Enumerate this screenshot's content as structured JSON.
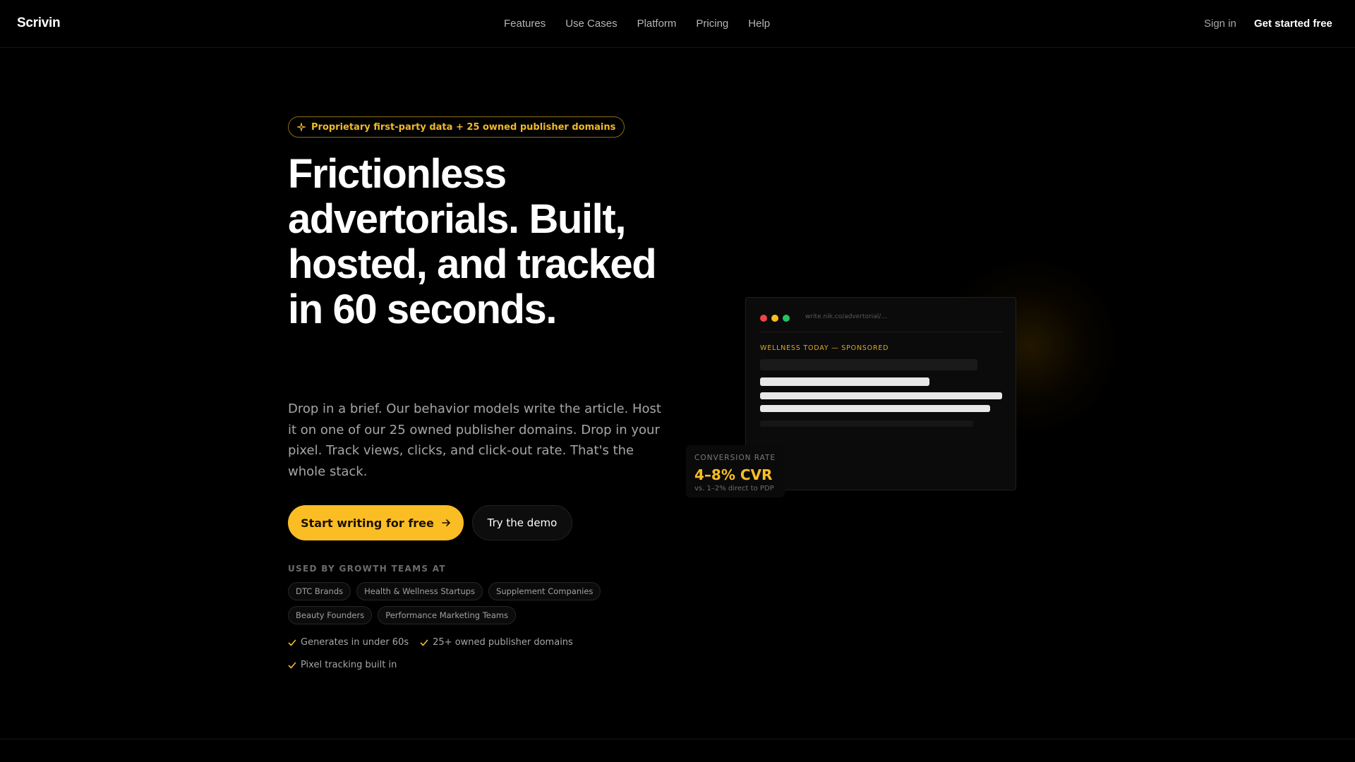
{
  "nav": {
    "logo": "Scrivin",
    "links": [
      "Features",
      "Use Cases",
      "Platform",
      "Pricing",
      "Help"
    ],
    "sign_in": "Sign in",
    "cta": "Get started free"
  },
  "hero": {
    "badge": "Proprietary first-party data + 25 owned publisher domains",
    "headline": "Frictionless advertorials. Built, hosted, and tracked in 60 seconds.",
    "lede": "Drop in a brief. Our behavior models write the article. Host it on one of our 25 owned publisher domains. Drop in your pixel. Track views, clicks, and click-out rate. That's the whole stack.",
    "primary_cta": "Start writing for free",
    "secondary_cta": "Try the demo",
    "used_by_label": "USED BY GROWTH TEAMS AT",
    "tags_row1": [
      "DTC Brands",
      "Health & Wellness Startups",
      "Supplement Companies"
    ],
    "tags_row2": [
      "Beauty Founders",
      "Performance Marketing Teams"
    ],
    "checks_row1": [
      "Generates in under 60s",
      "25+ owned publisher domains"
    ],
    "checks_row2": [
      "Pixel tracking built in"
    ]
  },
  "mockup": {
    "url": "write.nik.co/advertorial/...",
    "kicker": "WELLNESS TODAY — SPONSORED",
    "window_dot_colors": [
      "#ef4444",
      "#fbbd24",
      "#22c55e"
    ]
  },
  "stat": {
    "label": "CONVERSION RATE",
    "value": "4–8% CVR",
    "sub": "vs. 1–2% direct to PDP"
  },
  "colors": {
    "accent": "#fbbd24",
    "background": "#000000"
  }
}
